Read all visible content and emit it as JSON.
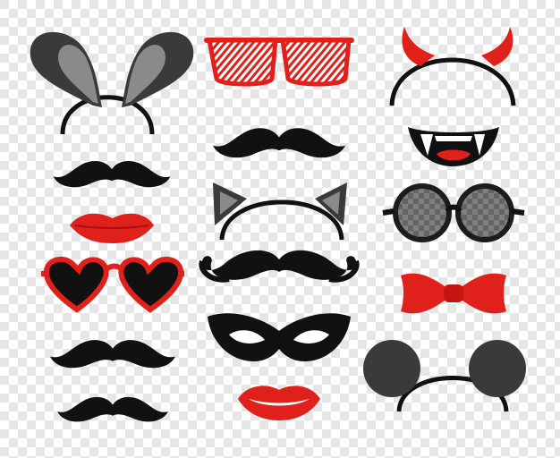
{
  "colors": {
    "checker_light": "#ffffff",
    "checker_dark": "#e6e6e6",
    "black": "#111111",
    "dark_gray": "#3a3a3a",
    "inner_gray": "#8a8a8a",
    "red": "#e0201b",
    "red_light": "#f3a09c",
    "white": "#ffffff",
    "lens_gray": "#6b6b6b"
  },
  "props": [
    {
      "name": "bunny-ears-headband"
    },
    {
      "name": "striped-red-glasses"
    },
    {
      "name": "devil-horns-headband"
    },
    {
      "name": "mustache"
    },
    {
      "name": "vampire-mouth"
    },
    {
      "name": "cat-ears-headband"
    },
    {
      "name": "round-glasses"
    },
    {
      "name": "lips"
    },
    {
      "name": "heart-glasses"
    },
    {
      "name": "bow-tie"
    },
    {
      "name": "carnival-mask"
    },
    {
      "name": "mouse-ears-headband"
    }
  ]
}
